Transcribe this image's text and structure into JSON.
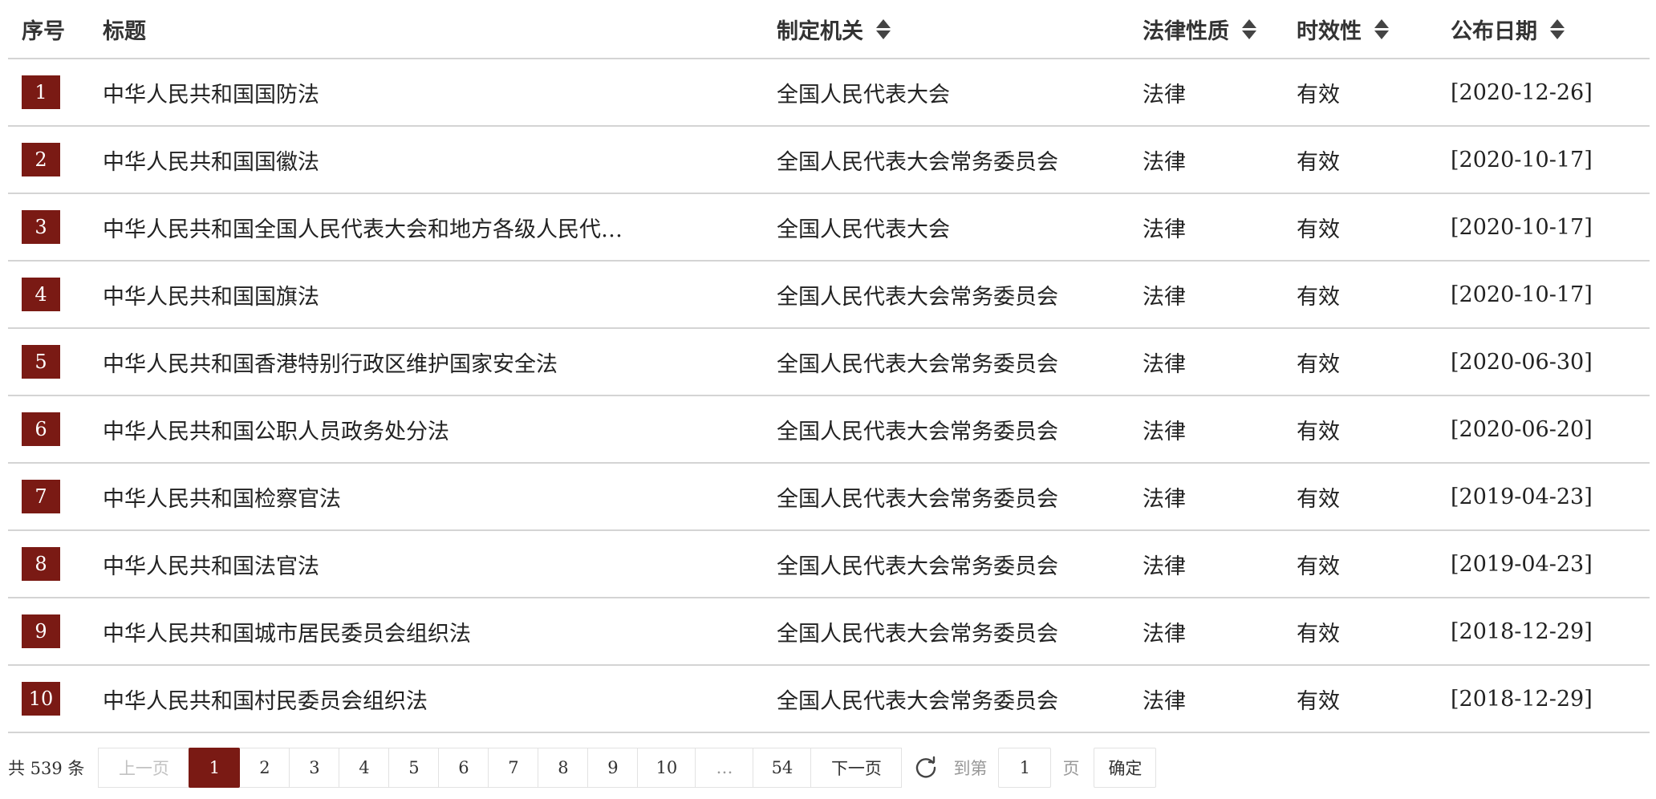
{
  "colors": {
    "accent": "#7a1a14",
    "border": "#d4d4d4"
  },
  "table": {
    "headers": {
      "no": "序号",
      "title": "标题",
      "org": "制定机关",
      "nature": "法律性质",
      "validity": "时效性",
      "date": "公布日期"
    },
    "rows": [
      {
        "no": "1",
        "title": "中华人民共和国国防法",
        "org": "全国人民代表大会",
        "nature": "法律",
        "validity": "有效",
        "date": "[2020-12-26]"
      },
      {
        "no": "2",
        "title": "中华人民共和国国徽法",
        "org": "全国人民代表大会常务委员会",
        "nature": "法律",
        "validity": "有效",
        "date": "[2020-10-17]"
      },
      {
        "no": "3",
        "title": "中华人民共和国全国人民代表大会和地方各级人民代…",
        "org": "全国人民代表大会",
        "nature": "法律",
        "validity": "有效",
        "date": "[2020-10-17]"
      },
      {
        "no": "4",
        "title": "中华人民共和国国旗法",
        "org": "全国人民代表大会常务委员会",
        "nature": "法律",
        "validity": "有效",
        "date": "[2020-10-17]"
      },
      {
        "no": "5",
        "title": "中华人民共和国香港特别行政区维护国家安全法",
        "org": "全国人民代表大会常务委员会",
        "nature": "法律",
        "validity": "有效",
        "date": "[2020-06-30]"
      },
      {
        "no": "6",
        "title": "中华人民共和国公职人员政务处分法",
        "org": "全国人民代表大会常务委员会",
        "nature": "法律",
        "validity": "有效",
        "date": "[2020-06-20]"
      },
      {
        "no": "7",
        "title": "中华人民共和国检察官法",
        "org": "全国人民代表大会常务委员会",
        "nature": "法律",
        "validity": "有效",
        "date": "[2019-04-23]"
      },
      {
        "no": "8",
        "title": "中华人民共和国法官法",
        "org": "全国人民代表大会常务委员会",
        "nature": "法律",
        "validity": "有效",
        "date": "[2019-04-23]"
      },
      {
        "no": "9",
        "title": "中华人民共和国城市居民委员会组织法",
        "org": "全国人民代表大会常务委员会",
        "nature": "法律",
        "validity": "有效",
        "date": "[2018-12-29]"
      },
      {
        "no": "10",
        "title": "中华人民共和国村民委员会组织法",
        "org": "全国人民代表大会常务委员会",
        "nature": "法律",
        "validity": "有效",
        "date": "[2018-12-29]"
      }
    ]
  },
  "pagination": {
    "total": "共 539 条",
    "prev": "上一页",
    "pages": [
      "1",
      "2",
      "3",
      "4",
      "5",
      "6",
      "7",
      "8",
      "9",
      "10",
      "…",
      "54"
    ],
    "current": "1",
    "next": "下一页",
    "refresh_icon": "refresh-icon",
    "goto_label": "到第",
    "goto_value": "1",
    "goto_unit": "页",
    "confirm": "确定"
  }
}
